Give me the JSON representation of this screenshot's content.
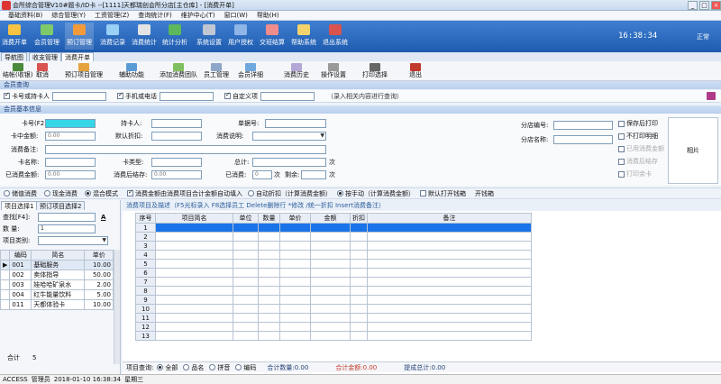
{
  "window": {
    "title": "会所综合管理V10#题卡/ID卡 --[1111]天都瑞创会所分店[主仓库] - [消费开单]",
    "min": "_",
    "max": "□",
    "close": "×"
  },
  "menu": [
    "基础资料(B)",
    "综合管理(Y)",
    "工资管理(Z)",
    "查询统计(F)",
    "维护中心(T)",
    "窗口(W)",
    "帮助(H)"
  ],
  "toolbar": [
    "消费开单",
    "会员管理",
    "预订管理",
    "消费记录",
    "消费统计",
    "统计分析",
    "系统设置",
    "用户授权",
    "交班结算",
    "帮助系统",
    "退出系统"
  ],
  "clock": "16:38:34",
  "status": "正常",
  "top_tabs": [
    "导航图",
    "收支管理",
    "消费开单"
  ],
  "toolbar2": [
    "结帐(收银)",
    "取消",
    "预订项目管理",
    "辅助功能",
    "添加消费团队",
    "员工管理",
    "会员详细",
    "消费历史",
    "操作设置",
    "打印选择",
    "退出"
  ],
  "member_query": {
    "header": "会员查询",
    "opts": [
      "卡号或持卡人",
      "手机或电话",
      "自定义项"
    ],
    "hint": "（录入相关内容进行查询）"
  },
  "basic_info": {
    "header": "会员基本信息",
    "labels": {
      "card_no": "卡号(F2):",
      "holder": "持卡人:",
      "bill_no": "单据号:",
      "card_money": "卡中金额:",
      "card_money_val": "0.00",
      "discount": "默认折扣:",
      "consume_desc": "消费说明:",
      "remark": "消费备注:",
      "card_name": "卡名称:",
      "card_type": "卡类型:",
      "total": "总计:",
      "times_unit": "次",
      "consumed_amt": "已消费金额:",
      "consumed_amt_val": "0.00",
      "after_balance": "消费后结存:",
      "after_balance_val": "0.00",
      "consumed_times": "已消费:",
      "consumed_times_val": "0",
      "times2": "次",
      "remain": "剩余:",
      "remain_unit": "次"
    },
    "branch_no": "分店编号:",
    "branch_name": "分店名称:",
    "photo": "相片",
    "print_opts": [
      "保存后打印",
      "不打印明细",
      "已用消费金额",
      "消费后结存",
      "打印余卡"
    ]
  },
  "mode_row": {
    "opts": [
      "储值消费",
      "现金消费",
      "混合模式"
    ],
    "auto": "消费金额由消费项目合计金额自动填入",
    "auto_disc": "自动折扣（计算消费金额）",
    "manual_disc": "按手动（计算消费金额）",
    "default_print": "默认打开钱箱",
    "open_drawer": "开钱箱"
  },
  "left_panel": {
    "tabs": [
      "项目选择1",
      "预订项目选择2"
    ],
    "find_label": "查找[F4]:",
    "qty_label": "数  量:",
    "qty_val": "1",
    "type_label": "项目类别:",
    "columns": [
      "编码",
      "简名",
      "单价"
    ],
    "rows": [
      [
        "001",
        "基础服务",
        "10.00"
      ],
      [
        "002",
        "卖体指导",
        "50.00"
      ],
      [
        "003",
        "娃哈哈矿泉水",
        "2.00"
      ],
      [
        "004",
        "红牛能量饮料",
        "5.00"
      ],
      [
        "011",
        "天都体验卡",
        "10.00"
      ]
    ],
    "total_label": "合计",
    "total_val": "5"
  },
  "right_panel": {
    "hint": "消费项目及描述（F5光标录入 F8选择员工 Delete删除行 *修改 /统一折扣 Insert消费备注）",
    "columns": [
      "序号",
      "项目简名",
      "单位",
      "数量",
      "单价",
      "金额",
      "折扣",
      "备注"
    ],
    "row_nums": [
      "1",
      "2",
      "3",
      "4",
      "5",
      "6",
      "7",
      "8",
      "9",
      "10",
      "11",
      "12",
      "13"
    ],
    "query_label": "项目查询:",
    "query_opts": [
      "全部",
      "品名",
      "拼音",
      "编码"
    ],
    "total_qty": "合计数量:0.00",
    "total_amt": "合计金额:0.00",
    "total_disc": "提成总计:0.00"
  },
  "statusbar": [
    "ACCESS",
    "管理员",
    "2018-01-10 16:38:34",
    "星期三"
  ],
  "colors": {
    "accent": "#1e5bb0",
    "selected_row": "#1a73e8",
    "highlight_field": "#37d6e6"
  }
}
